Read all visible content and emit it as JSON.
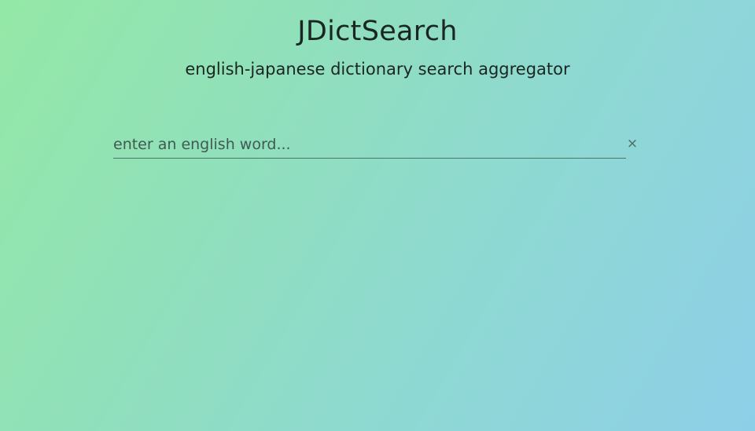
{
  "header": {
    "title": "JDictSearch",
    "subtitle": "english-japanese dictionary search aggregator"
  },
  "search": {
    "placeholder": "enter an english word...",
    "value": "",
    "clear_icon": "close-icon",
    "clear_glyph": "×"
  }
}
